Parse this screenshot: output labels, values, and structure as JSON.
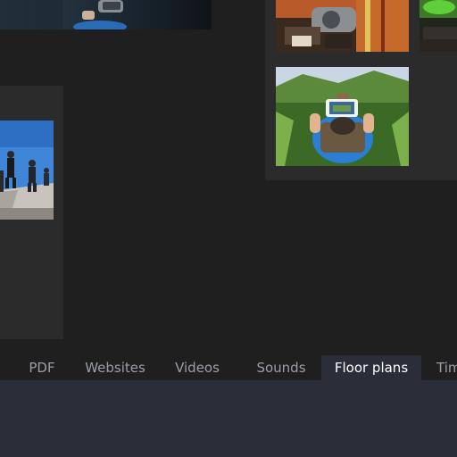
{
  "tabs": [
    {
      "label": "PDF",
      "active": false
    },
    {
      "label": "Websites",
      "active": false
    },
    {
      "label": "Videos",
      "active": false
    },
    {
      "label": "Sounds",
      "active": false
    },
    {
      "label": "Floor plans",
      "active": true
    },
    {
      "label": "Tim",
      "active": false
    }
  ],
  "colors": {
    "background": "#1f1f1f",
    "panel": "#2b2b2b",
    "active_tab": "#2b2e38",
    "tab_text": "#9a9ea6",
    "active_tab_text": "#ffffff"
  },
  "gallery": {
    "items": [
      {
        "icon": "action-camera-photo-thumbnail"
      },
      {
        "icon": "zipline-photo-thumbnail"
      },
      {
        "icon": "green-vehicle-photo-thumbnail"
      },
      {
        "icon": "hiker-phone-photo-thumbnail"
      },
      {
        "icon": "group-jump-photo-thumbnail"
      }
    ]
  }
}
